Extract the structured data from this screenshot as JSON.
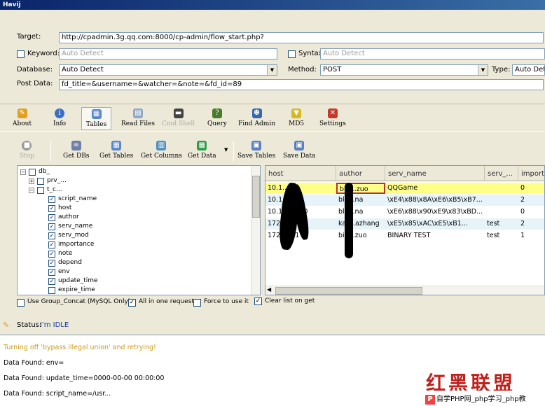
{
  "window": {
    "title": "Havij"
  },
  "form": {
    "target_label": "Target:",
    "target_value": "http://cpadmin.3g.qq.com:8000/cp-admin/flow_start.php?",
    "keyword_label": "Keyword:",
    "keyword_placeholder": "Auto Detect",
    "syntax_label": "Syntax:",
    "syntax_placeholder": "Auto Detect",
    "database_label": "Database:",
    "database_value": "Auto Detect",
    "method_label": "Method:",
    "method_value": "POST",
    "type_label": "Type:",
    "type_value": "Auto Detect",
    "postdata_label": "Post Data:",
    "postdata_value": "fd_title=&username=&watcher=&note=&fd_id=89"
  },
  "main_toolbar": {
    "items": [
      {
        "label": "About",
        "icon": "about-icon"
      },
      {
        "label": "Info",
        "icon": "info-icon"
      },
      {
        "label": "Tables",
        "icon": "tables-icon"
      },
      {
        "label": "Read Files",
        "icon": "read-files-icon"
      },
      {
        "label": "Cmd Shell",
        "icon": "cmd-shell-icon"
      },
      {
        "label": "Query",
        "icon": "query-icon"
      },
      {
        "label": "Find Admin",
        "icon": "find-admin-icon"
      },
      {
        "label": "MD5",
        "icon": "md5-icon"
      },
      {
        "label": "Settings",
        "icon": "settings-icon"
      }
    ]
  },
  "sub_toolbar": {
    "items": [
      {
        "label": "Stop",
        "icon": "stop-icon"
      },
      {
        "label": "Get DBs",
        "icon": "get-dbs-icon"
      },
      {
        "label": "Get Tables",
        "icon": "get-tables-icon"
      },
      {
        "label": "Get Columns",
        "icon": "get-columns-icon"
      },
      {
        "label": "Get Data",
        "icon": "get-data-icon"
      },
      {
        "label": "Save Tables",
        "icon": "save-tables-icon"
      },
      {
        "label": "Save Data",
        "icon": "save-data-icon"
      }
    ]
  },
  "tree": {
    "items": [
      {
        "label": "db_",
        "checked": false,
        "expander": "−"
      },
      {
        "label": "prv_...",
        "checked": false,
        "expander": "+"
      },
      {
        "label": "t_c...",
        "checked": false,
        "expander": "−"
      },
      {
        "label": "script_name",
        "checked": true
      },
      {
        "label": "host",
        "checked": true
      },
      {
        "label": "author",
        "checked": true
      },
      {
        "label": "serv_name",
        "checked": true
      },
      {
        "label": "serv_mod",
        "checked": true
      },
      {
        "label": "importance",
        "checked": true
      },
      {
        "label": "note",
        "checked": true
      },
      {
        "label": "depend",
        "checked": true
      },
      {
        "label": "env",
        "checked": true
      },
      {
        "label": "update_time",
        "checked": true
      },
      {
        "label": "expire_time",
        "checked": false
      }
    ]
  },
  "grid": {
    "columns": [
      "host",
      "author",
      "serv_name",
      "serv_...",
      "importa..."
    ],
    "rows": [
      [
        "10.1...51",
        "bin...zuo",
        "QQGame",
        "",
        "0"
      ],
      [
        "10.1...212",
        "bla...na",
        "\\xE4\\x88\\x8A\\xE6\\xB5\\xB7...",
        "",
        "2"
      ],
      [
        "10.1...2.120",
        "bla...na",
        "\\xE6\\x88\\x90\\xE9\\x83\\xBD...",
        "",
        "0"
      ],
      [
        "172...7.11",
        "kat...azhang",
        "\\xE5\\x85\\xAC\\xE5\\xB1...",
        "test",
        "2"
      ],
      [
        "172...171",
        "bin...zuo",
        "BINARY TEST",
        "test",
        "1"
      ]
    ]
  },
  "options": {
    "group_concat": "Use Group_Concat (MySQL Only)",
    "all_in_one": "All in one request.",
    "force": "Force to use it",
    "clear_list": "Clear list on get"
  },
  "status": {
    "label": "Status:",
    "value": "I'm IDLE"
  },
  "log": {
    "lines": [
      "Turning off 'bypass illegal union' and retrying!",
      "Data Found: env=",
      "Data Found: update_time=0000-00-00 00:00:00",
      "Data Found: script_name=/usr..."
    ]
  },
  "watermark": {
    "text": "红黑联盟",
    "bar": "自学PHP网_php学习_php教"
  },
  "colors": {
    "log_warning": "#c89a1e",
    "status_value": "#1a3c9e",
    "selected_row": "#ffff88"
  }
}
